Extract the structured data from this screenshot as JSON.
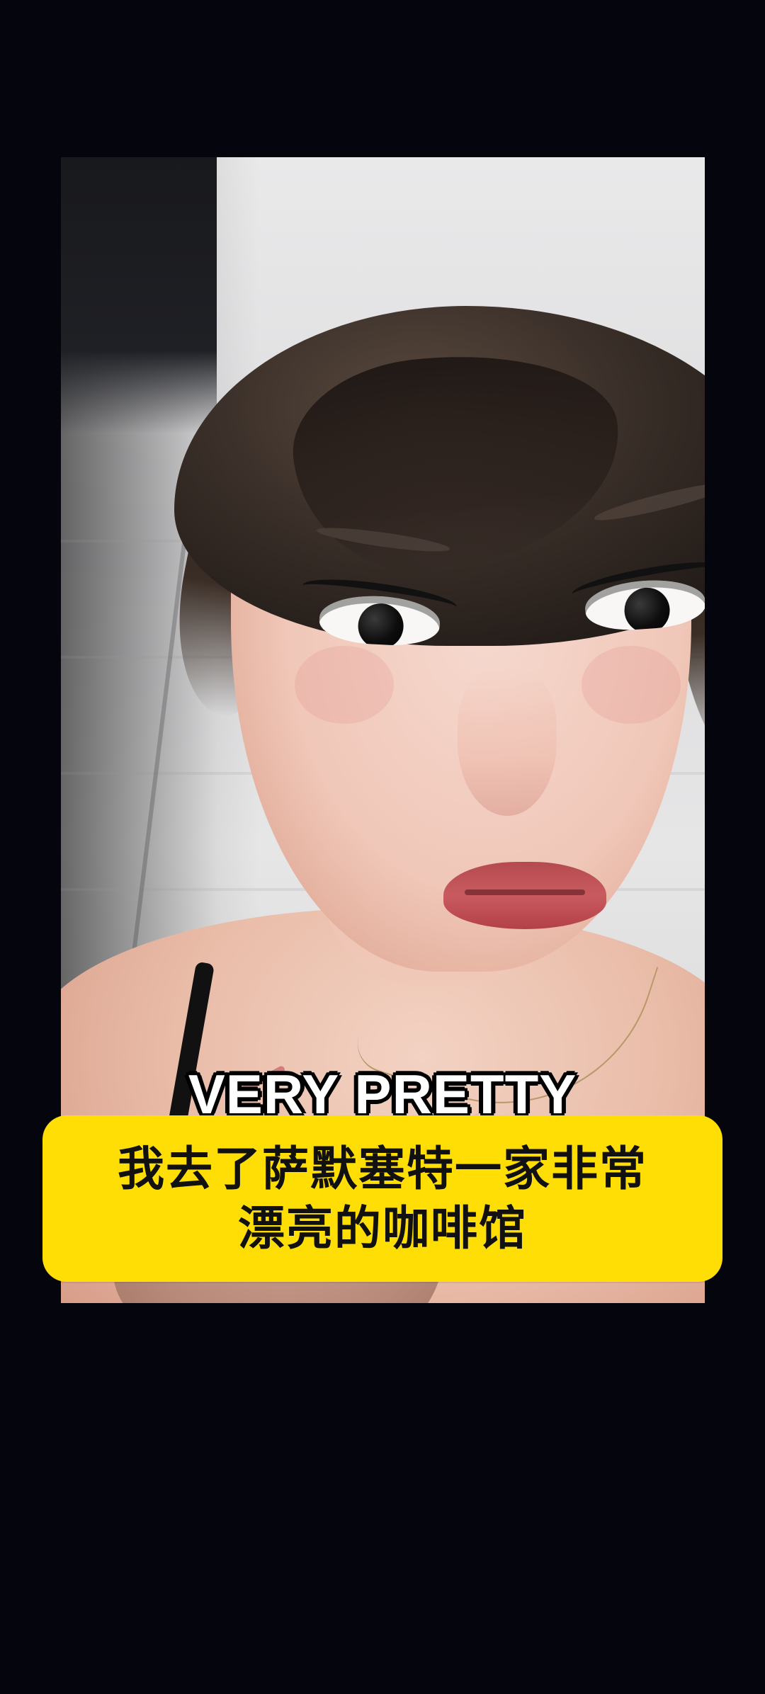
{
  "video": {
    "overlay_text": "VERY PRETTY",
    "caption_lines": [
      "我去了萨默塞特一家非常",
      "漂亮的咖啡馆"
    ]
  },
  "colors": {
    "page_bg": "#05060d",
    "caption_bg": "#ffde05",
    "caption_text": "#111111",
    "overlay_text": "#ffffff",
    "overlay_outline": "#000000"
  }
}
